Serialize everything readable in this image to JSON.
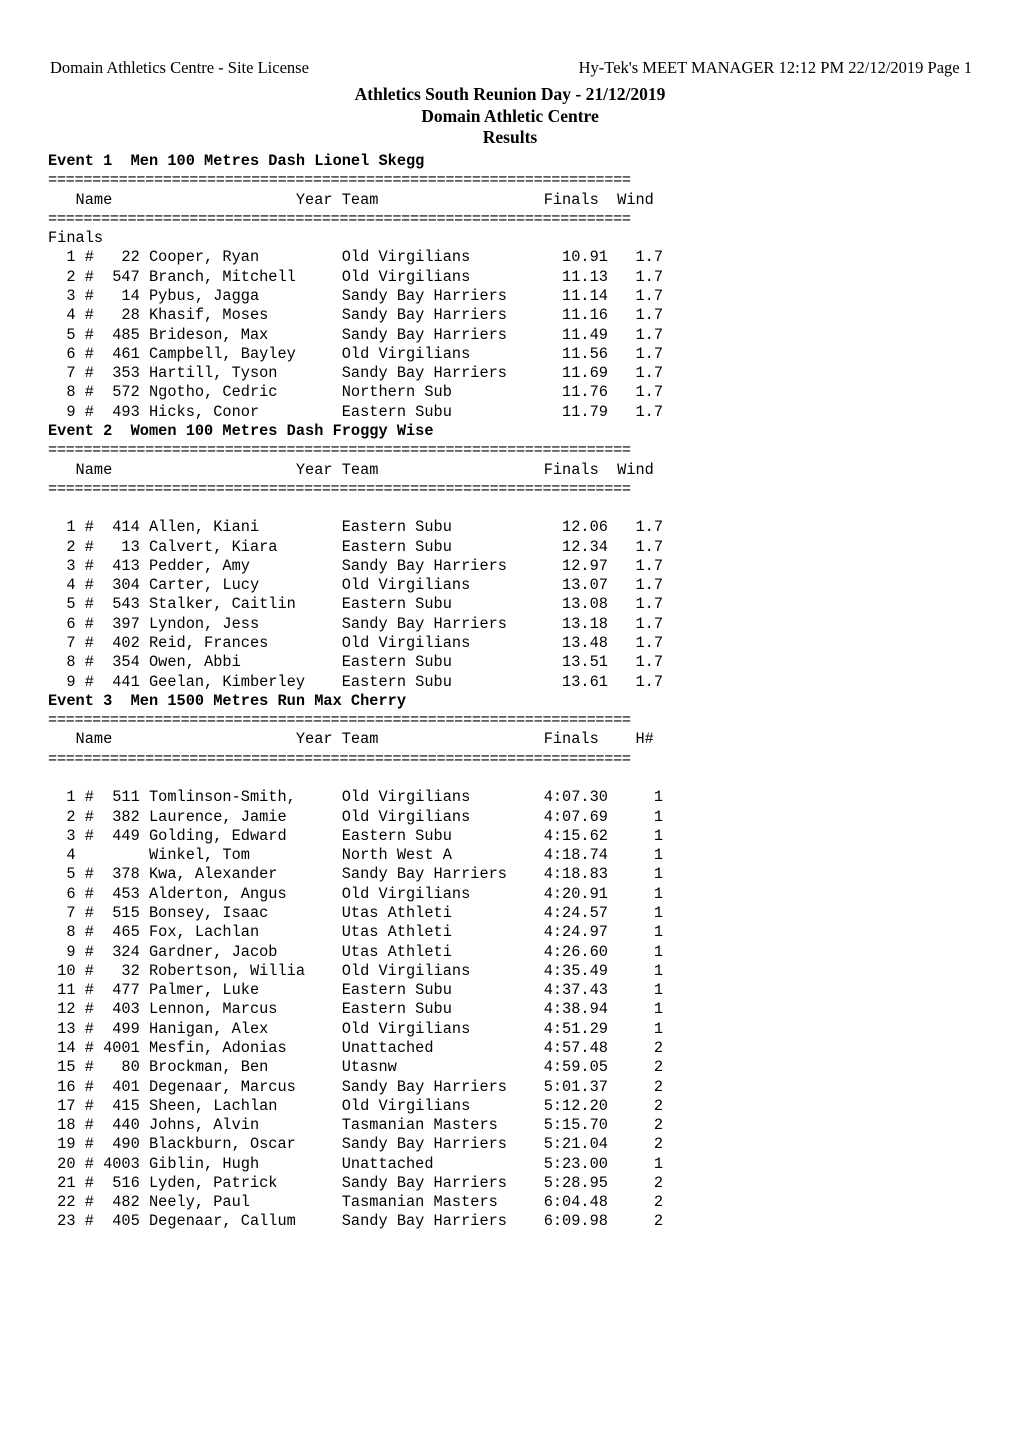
{
  "header": {
    "left": "Domain Athletics Centre - Site License",
    "right": "Hy-Tek's MEET MANAGER  12:12 PM  22/12/2019  Page 1"
  },
  "title": {
    "line1": "Athletics South Reunion Day - 21/12/2019",
    "line2": "Domain Athletic Centre",
    "line3": "Results"
  },
  "column_headers": {
    "name": "Name",
    "year": "Year",
    "team": "Team",
    "finals": "Finals",
    "wind": "Wind",
    "heat": "H#"
  },
  "separator": "==================================================================",
  "events": [
    {
      "id": "event-1",
      "title": "Event 1  Men 100 Metres Dash Lionel Skegg",
      "header_line": "   Name                    Year Team                  Finals  Wind",
      "section_label": "Finals",
      "result_col": "Finals",
      "last_col": "Wind",
      "rows": [
        {
          "place": "1",
          "hash": "#",
          "bib": "22",
          "name": "Cooper, Ryan",
          "year": "",
          "team": "Old Virgilians",
          "result": "10.91",
          "extra": "1.7"
        },
        {
          "place": "2",
          "hash": "#",
          "bib": "547",
          "name": "Branch, Mitchell",
          "year": "",
          "team": "Old Virgilians",
          "result": "11.13",
          "extra": "1.7"
        },
        {
          "place": "3",
          "hash": "#",
          "bib": "14",
          "name": "Pybus, Jagga",
          "year": "",
          "team": "Sandy Bay Harriers",
          "result": "11.14",
          "extra": "1.7"
        },
        {
          "place": "4",
          "hash": "#",
          "bib": "28",
          "name": "Khasif, Moses",
          "year": "",
          "team": "Sandy Bay Harriers",
          "result": "11.16",
          "extra": "1.7"
        },
        {
          "place": "5",
          "hash": "#",
          "bib": "485",
          "name": "Brideson, Max",
          "year": "",
          "team": "Sandy Bay Harriers",
          "result": "11.49",
          "extra": "1.7"
        },
        {
          "place": "6",
          "hash": "#",
          "bib": "461",
          "name": "Campbell, Bayley",
          "year": "",
          "team": "Old Virgilians",
          "result": "11.56",
          "extra": "1.7"
        },
        {
          "place": "7",
          "hash": "#",
          "bib": "353",
          "name": "Hartill, Tyson",
          "year": "",
          "team": "Sandy Bay Harriers",
          "result": "11.69",
          "extra": "1.7"
        },
        {
          "place": "8",
          "hash": "#",
          "bib": "572",
          "name": "Ngotho, Cedric",
          "year": "",
          "team": "Northern Sub",
          "result": "11.76",
          "extra": "1.7"
        },
        {
          "place": "9",
          "hash": "#",
          "bib": "493",
          "name": "Hicks, Conor",
          "year": "",
          "team": "Eastern Subu",
          "result": "11.79",
          "extra": "1.7"
        }
      ]
    },
    {
      "id": "event-2",
      "title": "Event 2  Women 100 Metres Dash Froggy Wise",
      "header_line": "   Name                    Year Team                  Finals  Wind",
      "section_label": "",
      "result_col": "Finals",
      "last_col": "Wind",
      "rows": [
        {
          "place": "1",
          "hash": "#",
          "bib": "414",
          "name": "Allen, Kiani",
          "year": "",
          "team": "Eastern Subu",
          "result": "12.06",
          "extra": "1.7"
        },
        {
          "place": "2",
          "hash": "#",
          "bib": "13",
          "name": "Calvert, Kiara",
          "year": "",
          "team": "Eastern Subu",
          "result": "12.34",
          "extra": "1.7"
        },
        {
          "place": "3",
          "hash": "#",
          "bib": "413",
          "name": "Pedder, Amy",
          "year": "",
          "team": "Sandy Bay Harriers",
          "result": "12.97",
          "extra": "1.7"
        },
        {
          "place": "4",
          "hash": "#",
          "bib": "304",
          "name": "Carter, Lucy",
          "year": "",
          "team": "Old Virgilians",
          "result": "13.07",
          "extra": "1.7"
        },
        {
          "place": "5",
          "hash": "#",
          "bib": "543",
          "name": "Stalker, Caitlin",
          "year": "",
          "team": "Eastern Subu",
          "result": "13.08",
          "extra": "1.7"
        },
        {
          "place": "6",
          "hash": "#",
          "bib": "397",
          "name": "Lyndon, Jess",
          "year": "",
          "team": "Sandy Bay Harriers",
          "result": "13.18",
          "extra": "1.7"
        },
        {
          "place": "7",
          "hash": "#",
          "bib": "402",
          "name": "Reid, Frances",
          "year": "",
          "team": "Old Virgilians",
          "result": "13.48",
          "extra": "1.7"
        },
        {
          "place": "8",
          "hash": "#",
          "bib": "354",
          "name": "Owen, Abbi",
          "year": "",
          "team": "Eastern Subu",
          "result": "13.51",
          "extra": "1.7"
        },
        {
          "place": "9",
          "hash": "#",
          "bib": "441",
          "name": "Geelan, Kimberley",
          "year": "",
          "team": "Eastern Subu",
          "result": "13.61",
          "extra": "1.7"
        }
      ]
    },
    {
      "id": "event-3",
      "title": "Event 3  Men 1500 Metres Run Max Cherry",
      "header_line": "   Name                    Year Team                  Finals    H#",
      "section_label": "",
      "result_col": "Finals",
      "last_col": "H#",
      "rows": [
        {
          "place": "1",
          "hash": "#",
          "bib": "511",
          "name": "Tomlinson-Smith,",
          "year": "",
          "team": "Old Virgilians",
          "result": "4:07.30",
          "extra": "1"
        },
        {
          "place": "2",
          "hash": "#",
          "bib": "382",
          "name": "Laurence, Jamie",
          "year": "",
          "team": "Old Virgilians",
          "result": "4:07.69",
          "extra": "1"
        },
        {
          "place": "3",
          "hash": "#",
          "bib": "449",
          "name": "Golding, Edward",
          "year": "",
          "team": "Eastern Subu",
          "result": "4:15.62",
          "extra": "1"
        },
        {
          "place": "4",
          "hash": "",
          "bib": "",
          "name": "Winkel, Tom",
          "year": "",
          "team": "North West A",
          "result": "4:18.74",
          "extra": "1"
        },
        {
          "place": "5",
          "hash": "#",
          "bib": "378",
          "name": "Kwa, Alexander",
          "year": "",
          "team": "Sandy Bay Harriers",
          "result": "4:18.83",
          "extra": "1"
        },
        {
          "place": "6",
          "hash": "#",
          "bib": "453",
          "name": "Alderton, Angus",
          "year": "",
          "team": "Old Virgilians",
          "result": "4:20.91",
          "extra": "1"
        },
        {
          "place": "7",
          "hash": "#",
          "bib": "515",
          "name": "Bonsey, Isaac",
          "year": "",
          "team": "Utas Athleti",
          "result": "4:24.57",
          "extra": "1"
        },
        {
          "place": "8",
          "hash": "#",
          "bib": "465",
          "name": "Fox, Lachlan",
          "year": "",
          "team": "Utas Athleti",
          "result": "4:24.97",
          "extra": "1"
        },
        {
          "place": "9",
          "hash": "#",
          "bib": "324",
          "name": "Gardner, Jacob",
          "year": "",
          "team": "Utas Athleti",
          "result": "4:26.60",
          "extra": "1"
        },
        {
          "place": "10",
          "hash": "#",
          "bib": "32",
          "name": "Robertson, Willia",
          "year": "",
          "team": "Old Virgilians",
          "result": "4:35.49",
          "extra": "1"
        },
        {
          "place": "11",
          "hash": "#",
          "bib": "477",
          "name": "Palmer, Luke",
          "year": "",
          "team": "Eastern Subu",
          "result": "4:37.43",
          "extra": "1"
        },
        {
          "place": "12",
          "hash": "#",
          "bib": "403",
          "name": "Lennon, Marcus",
          "year": "",
          "team": "Eastern Subu",
          "result": "4:38.94",
          "extra": "1"
        },
        {
          "place": "13",
          "hash": "#",
          "bib": "499",
          "name": "Hanigan, Alex",
          "year": "",
          "team": "Old Virgilians",
          "result": "4:51.29",
          "extra": "1"
        },
        {
          "place": "14",
          "hash": "#",
          "bib": "4001",
          "name": "Mesfin, Adonias",
          "year": "",
          "team": "Unattached",
          "result": "4:57.48",
          "extra": "2"
        },
        {
          "place": "15",
          "hash": "#",
          "bib": "80",
          "name": "Brockman, Ben",
          "year": "",
          "team": "Utasnw",
          "result": "4:59.05",
          "extra": "2"
        },
        {
          "place": "16",
          "hash": "#",
          "bib": "401",
          "name": "Degenaar, Marcus",
          "year": "",
          "team": "Sandy Bay Harriers",
          "result": "5:01.37",
          "extra": "2"
        },
        {
          "place": "17",
          "hash": "#",
          "bib": "415",
          "name": "Sheen, Lachlan",
          "year": "",
          "team": "Old Virgilians",
          "result": "5:12.20",
          "extra": "2"
        },
        {
          "place": "18",
          "hash": "#",
          "bib": "440",
          "name": "Johns, Alvin",
          "year": "",
          "team": "Tasmanian Masters",
          "result": "5:15.70",
          "extra": "2"
        },
        {
          "place": "19",
          "hash": "#",
          "bib": "490",
          "name": "Blackburn, Oscar",
          "year": "",
          "team": "Sandy Bay Harriers",
          "result": "5:21.04",
          "extra": "2"
        },
        {
          "place": "20",
          "hash": "#",
          "bib": "4003",
          "name": "Giblin, Hugh",
          "year": "",
          "team": "Unattached",
          "result": "5:23.00",
          "extra": "1"
        },
        {
          "place": "21",
          "hash": "#",
          "bib": "516",
          "name": "Lyden, Patrick",
          "year": "",
          "team": "Sandy Bay Harriers",
          "result": "5:28.95",
          "extra": "2"
        },
        {
          "place": "22",
          "hash": "#",
          "bib": "482",
          "name": "Neely, Paul",
          "year": "",
          "team": "Tasmanian Masters",
          "result": "6:04.48",
          "extra": "2"
        },
        {
          "place": "23",
          "hash": "#",
          "bib": "405",
          "name": "Degenaar, Callum",
          "year": "",
          "team": "Sandy Bay Harriers",
          "result": "6:09.98",
          "extra": "2"
        }
      ]
    }
  ]
}
